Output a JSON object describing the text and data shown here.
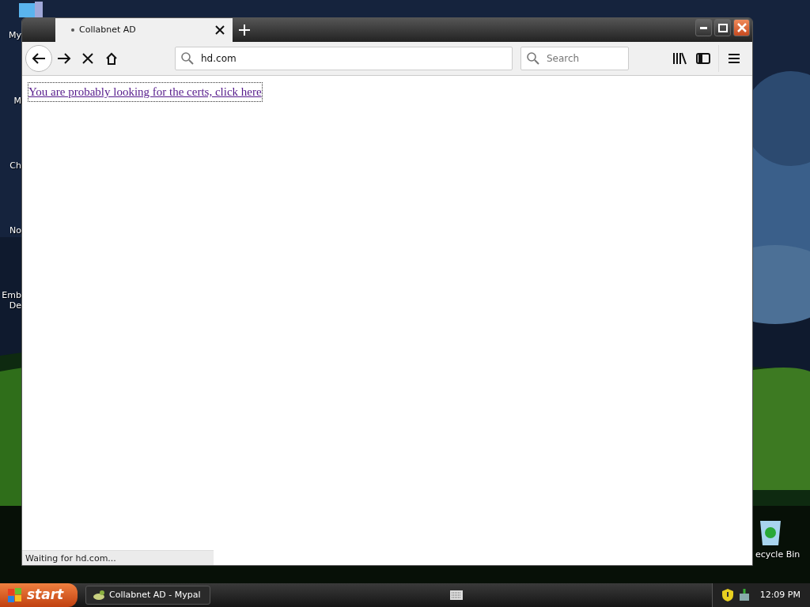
{
  "desktop_icons": [
    {
      "lines": [
        "My"
      ]
    },
    {
      "lines": [
        "M"
      ]
    },
    {
      "lines": [
        "Ch"
      ]
    },
    {
      "lines": [
        "No"
      ]
    },
    {
      "lines": [
        "Emb",
        "De"
      ]
    }
  ],
  "recycle_bin": {
    "label": "ecycle Bin"
  },
  "browser": {
    "tabs": [
      {
        "title": "Collabnet AD",
        "selected": true,
        "loading": true
      }
    ],
    "address": "hd.com",
    "search": {
      "placeholder": "Search"
    },
    "page": {
      "link": "You are probably looking for the certs, click here"
    },
    "status": "Waiting for hd.com..."
  },
  "taskbar": {
    "start": "start",
    "tasks": [
      {
        "label": "Collabnet AD - Mypal",
        "selected": false
      }
    ],
    "clock": "12:09 PM"
  }
}
